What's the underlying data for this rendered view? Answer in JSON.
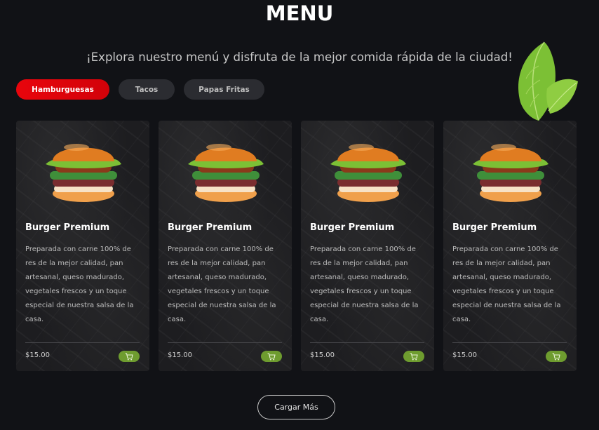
{
  "header": {
    "title": "MENU",
    "subtitle": "¡Explora nuestro menú y disfruta de la mejor comida rápida de la ciudad!"
  },
  "tabs": [
    {
      "label": "Hamburguesas",
      "active": true
    },
    {
      "label": "Tacos",
      "active": false
    },
    {
      "label": "Papas Fritas",
      "active": false
    }
  ],
  "cards": [
    {
      "name": "Burger Premium",
      "description": "Preparada con carne 100% de res de la mejor calidad, pan artesanal, queso madurado, vegetales frescos y un toque especial de nuestra salsa de la casa.",
      "price": "$15.00",
      "cart_icon": "shopping-cart-icon"
    },
    {
      "name": "Burger Premium",
      "description": "Preparada con carne 100% de res de la mejor calidad, pan artesanal, queso madurado, vegetales frescos y un toque especial de nuestra salsa de la casa.",
      "price": "$15.00",
      "cart_icon": "shopping-cart-icon"
    },
    {
      "name": "Burger Premium",
      "description": "Preparada con carne 100% de res de la mejor calidad, pan artesanal, queso madurado, vegetales frescos y un toque especial de nuestra salsa de la casa.",
      "price": "$15.00",
      "cart_icon": "shopping-cart-icon"
    },
    {
      "name": "Burger Premium",
      "description": "Preparada con carne 100% de res de la mejor calidad, pan artesanal, queso madurado, vegetales frescos y un toque especial de nuestra salsa de la casa.",
      "price": "$15.00",
      "cart_icon": "shopping-cart-icon"
    }
  ],
  "load_more_label": "Cargar Más",
  "colors": {
    "background": "#111216",
    "accent_red": "#e8050c",
    "cart_green": "#6e9c2f",
    "tab_inactive": "#2b2c31"
  }
}
